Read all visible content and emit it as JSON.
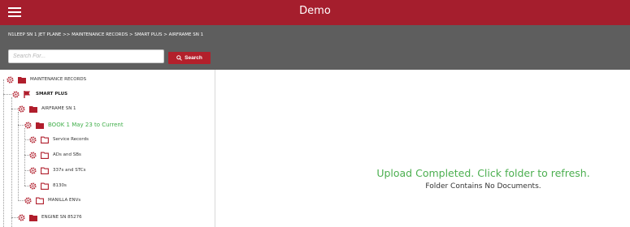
{
  "header": {
    "title": "Demo",
    "menu_icon": "hamburger-icon",
    "brand_color": "#a51e2d"
  },
  "toolbar": {
    "breadcrumb": "N1LEEP SN 1 JET PLANE >> MAINTENANCE RECORDS > SMART PLUS > AIRFRAME SN 1",
    "search_placeholder": "Search For...",
    "search_label": "Search",
    "search_icon": "magnifier-icon"
  },
  "tree": {
    "gear_icon": "gear-icon",
    "nodes": [
      {
        "label": "MAINTENANCE RECORDS",
        "icon": "folder-filled-icon"
      },
      {
        "label": "SMART PLUS",
        "icon": "flag-icon"
      },
      {
        "label": "AIRFRAME SN 1",
        "icon": "folder-filled-icon"
      },
      {
        "label": "BOOK 1 May 23 to Current",
        "icon": "folder-filled-icon",
        "selected": true
      },
      {
        "label": "Service Records",
        "icon": "folder-outline-icon"
      },
      {
        "label": "ADs and SBs",
        "icon": "folder-outline-icon"
      },
      {
        "label": "337s and STCs",
        "icon": "folder-outline-icon"
      },
      {
        "label": "8130s",
        "icon": "folder-outline-icon"
      },
      {
        "label": "MANILLA ENVs",
        "icon": "folder-outline-icon"
      },
      {
        "label": "ENGINE SN 85276",
        "icon": "folder-filled-icon"
      }
    ]
  },
  "main": {
    "upload_message": "Upload Completed. Click folder to refresh.",
    "empty_message": "Folder Contains No Documents.",
    "success_color": "#4caf50"
  }
}
